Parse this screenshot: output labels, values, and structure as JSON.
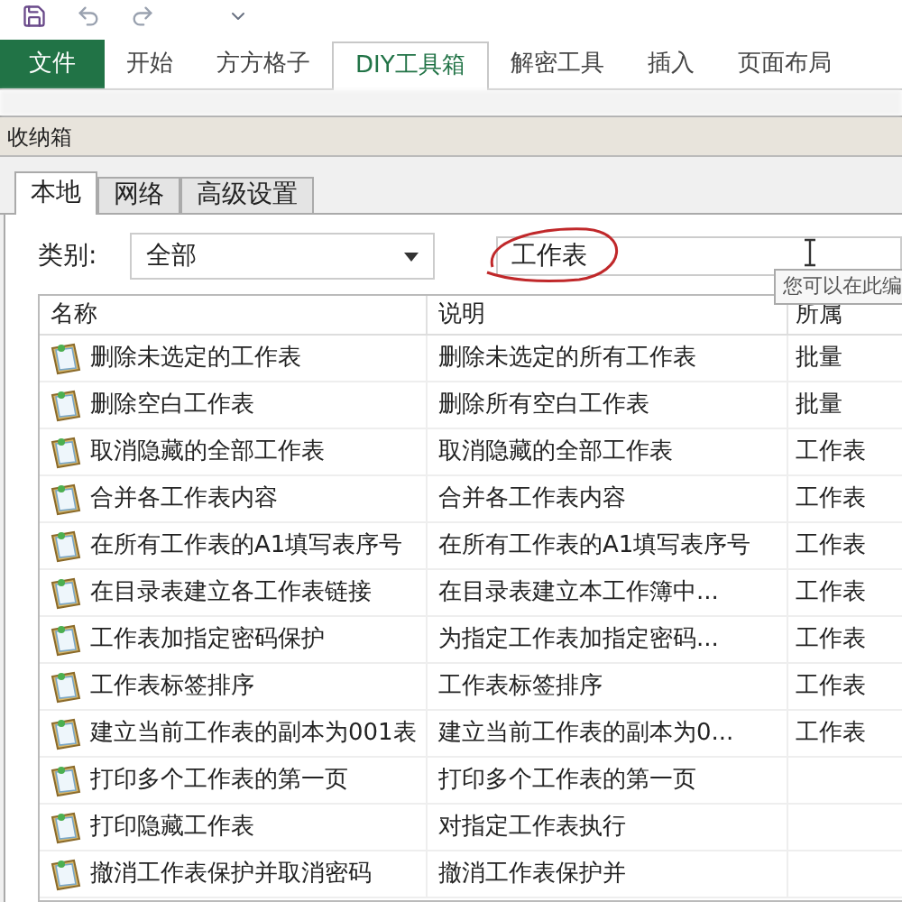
{
  "ribbon_tabs": [
    {
      "label": "文件",
      "kind": "file",
      "selected": false
    },
    {
      "label": "开始",
      "kind": "tab",
      "selected": false
    },
    {
      "label": "方方格子",
      "kind": "tab",
      "selected": false
    },
    {
      "label": "DIY工具箱",
      "kind": "tab",
      "selected": true
    },
    {
      "label": "解密工具",
      "kind": "tab",
      "selected": false
    },
    {
      "label": "插入",
      "kind": "tab",
      "selected": false
    },
    {
      "label": "页面布局",
      "kind": "tab",
      "selected": false
    }
  ],
  "dialog": {
    "title": "收纳箱",
    "tabs": [
      {
        "label": "本地",
        "selected": true
      },
      {
        "label": "网络",
        "selected": false
      },
      {
        "label": "高级设置",
        "selected": false
      }
    ],
    "category_label": "类别:",
    "category_value": "全部",
    "search_value": "工作表",
    "tooltip": "您可以在此编",
    "table": {
      "columns": [
        "名称",
        "说明",
        "所属"
      ],
      "rows": [
        {
          "name": "删除未选定的工作表",
          "description": "删除未选定的所有工作表",
          "column_3": "批量"
        },
        {
          "name": "删除空白工作表",
          "description": "删除所有空白工作表",
          "column_3": "批量"
        },
        {
          "name": "取消隐藏的全部工作表",
          "description": "取消隐藏的全部工作表",
          "column_3": "工作表"
        },
        {
          "name": "合并各工作表内容",
          "description": "合并各工作表内容",
          "column_3": "工作表"
        },
        {
          "name": "在所有工作表的A1填写表序号",
          "description": "在所有工作表的A1填写表序号",
          "column_3": "工作表"
        },
        {
          "name": "在目录表建立各工作表链接",
          "description": "在目录表建立本工作簿中...",
          "column_3": "工作表"
        },
        {
          "name": "工作表加指定密码保护",
          "description": "为指定工作表加指定密码...",
          "column_3": "工作表"
        },
        {
          "name": "工作表标签排序",
          "description": "工作表标签排序",
          "column_3": "工作表"
        },
        {
          "name": "建立当前工作表的副本为001表",
          "description": "建立当前工作表的副本为0...",
          "column_3": "工作表"
        },
        {
          "name": "打印多个工作表的第一页",
          "description": "打印多个工作表的第一页"
        },
        {
          "name": "打印隐藏工作表",
          "description": "对指定工作表执行"
        },
        {
          "name": "撤消工作表保护并取消密码",
          "description": "撤消工作表保护并"
        }
      ]
    }
  }
}
